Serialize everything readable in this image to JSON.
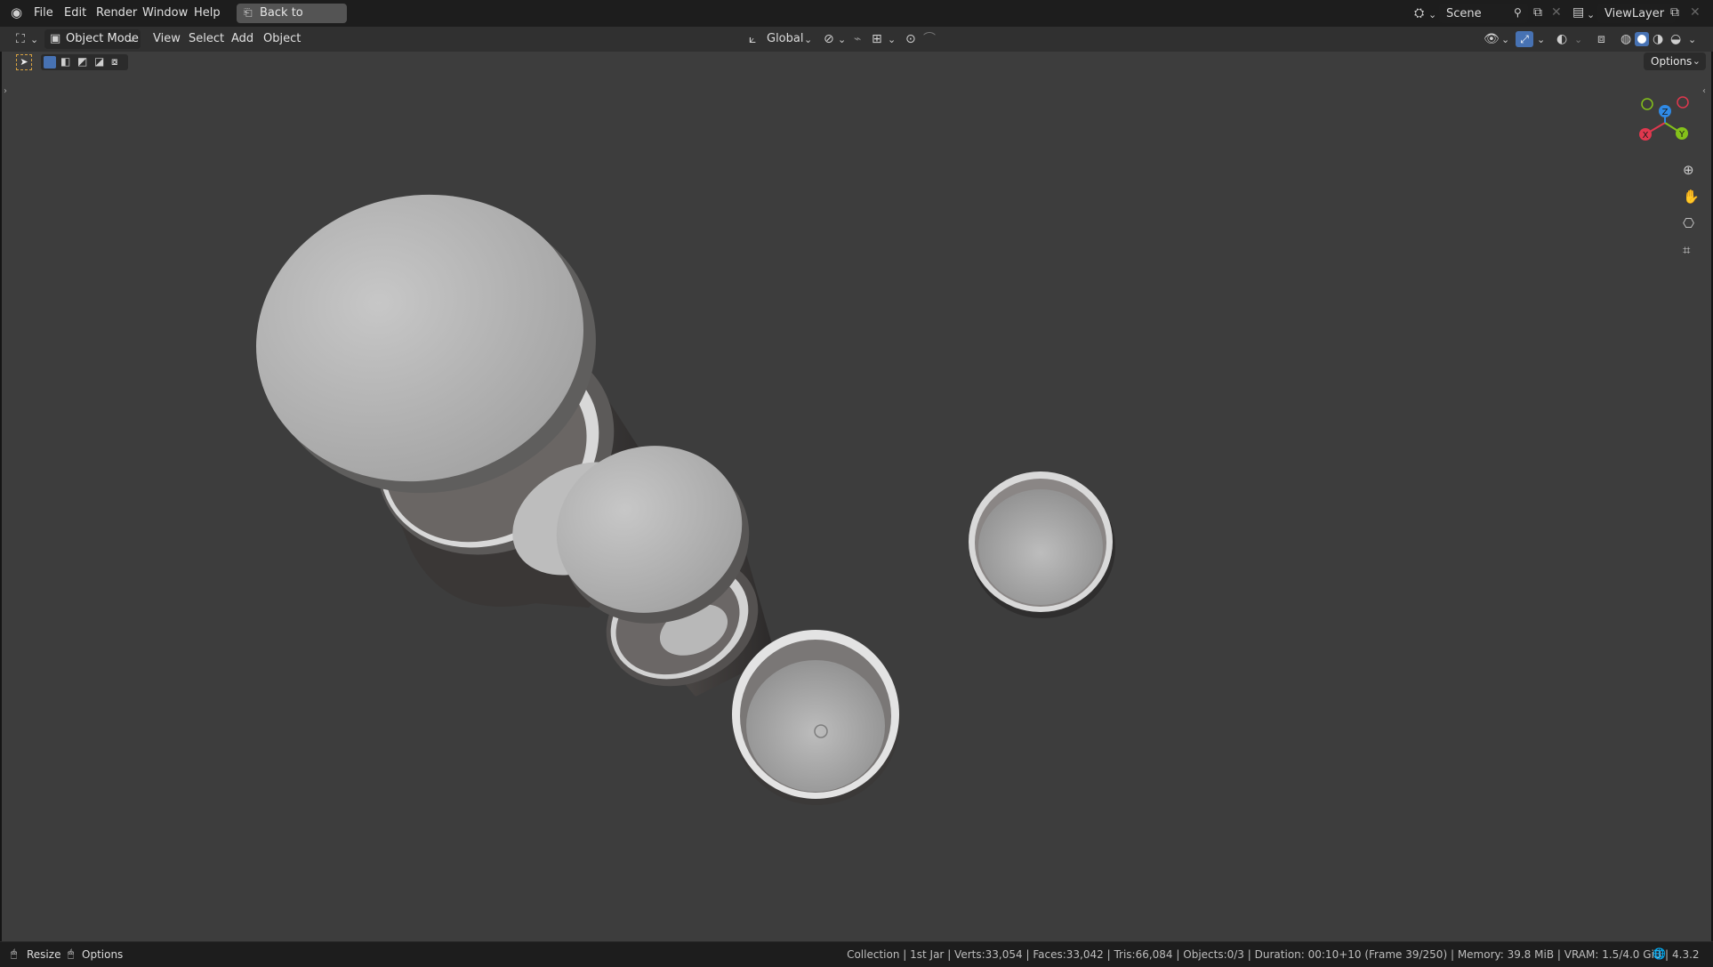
{
  "topbar": {
    "menus": [
      "File",
      "Edit",
      "Render",
      "Window",
      "Help"
    ],
    "back_button": "Back to Previous",
    "scene_name": "Scene",
    "view_layer": "ViewLayer"
  },
  "header": {
    "mode": "Object Mode",
    "menus": [
      "View",
      "Select",
      "Add",
      "Object"
    ],
    "transform_orientation": "Global",
    "options_label": "Options"
  },
  "gizmo": {
    "axes": [
      "X",
      "Y",
      "Z"
    ],
    "colors": {
      "x": "#e0384e",
      "y": "#84c21a",
      "z": "#2f8ae6"
    }
  },
  "status": {
    "left_resize": "Resize",
    "left_options": "Options",
    "collection": "Collection",
    "active": "1st Jar",
    "verts": "Verts:33,054",
    "faces": "Faces:33,042",
    "tris": "Tris:66,084",
    "objects": "Objects:0/3",
    "duration": "Duration: 00:10+10 (Frame 39/250)",
    "memory": "Memory: 39.8 MiB",
    "vram": "VRAM: 1.5/4.0 GiB",
    "version": "4.3.2"
  }
}
